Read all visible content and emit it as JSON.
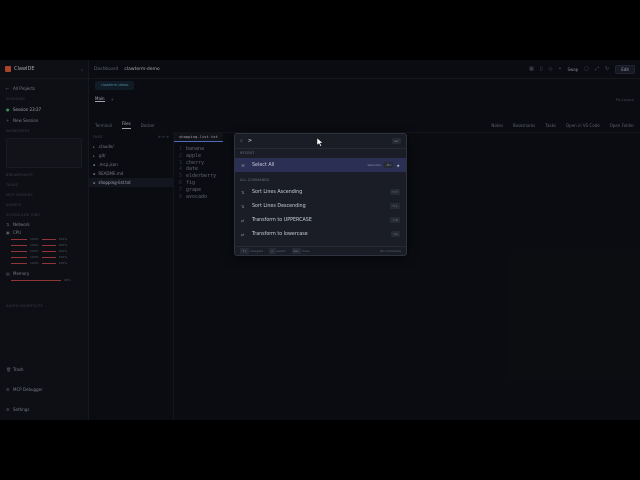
{
  "app": {
    "brand": "ClawIDE",
    "brand_sub": ""
  },
  "sidebar": {
    "back_label": "All Projects",
    "sections": {
      "sessions": "SESSIONS",
      "worktrees": "WORKTREES",
      "breakpoints": "BREAKPOINTS",
      "tasks": "TASKS",
      "mcp_servers": "MCP SERVERS",
      "agents": "AGENTS",
      "scheduled_jobs": "SCHEDULED JOBS",
      "saved_shortcuts": "SAVED SHORTCUTS"
    },
    "session_name": "Session 23:27",
    "new_session": "New Session",
    "trash": "Trash",
    "mcp_debugger": "MCP Debugger",
    "settings": "Settings",
    "metrics": {
      "network_label": "Network",
      "cpu_label": "CPU",
      "memory_label": "Memory",
      "cpu_rows": [
        "100%",
        "100%",
        "100%",
        "100%",
        "100%"
      ],
      "cpu_rows_right": [
        "100%",
        "100%",
        "100%",
        "100%",
        "100%"
      ],
      "memory_value": "99%"
    }
  },
  "topbar": {
    "crumb_1": "Dashboard",
    "crumb_2": "clawterm-demo",
    "branch": "Swap",
    "edit_label": "Edit"
  },
  "workspace": {
    "session_tag": "clawterm-demo",
    "tab_main": "Main",
    "right_note": "Pin Layout",
    "subtabs": [
      "Terminal",
      "Files",
      "Docker"
    ],
    "subtabs_right": [
      "Notes",
      "Bookmarks",
      "Tasks",
      "Open in VS Code",
      "Open Folder"
    ]
  },
  "filetree": {
    "header": "FILES",
    "items": [
      ".claude/",
      ".git/",
      ".mcp.json",
      "README.md",
      "shopping-list.txt"
    ]
  },
  "editor": {
    "tab": "shopping-list.txt",
    "lines": [
      "banana",
      "apple",
      "cherry",
      "date",
      "elderberry",
      "fig",
      "grape",
      "avocado"
    ]
  },
  "palette": {
    "query": ">",
    "esc_hint": "esc",
    "recent_label": "RECENT",
    "recent_item": "Select All",
    "recent_hint": "Selection",
    "all_label": "ALL COMMANDS",
    "commands": [
      "Sort Lines Ascending",
      "Sort Lines Descending",
      "Transform to UPPERCASE",
      "Transform to lowercase"
    ],
    "footer": [
      "navigate",
      "select",
      "close"
    ],
    "count": "36 commands"
  }
}
